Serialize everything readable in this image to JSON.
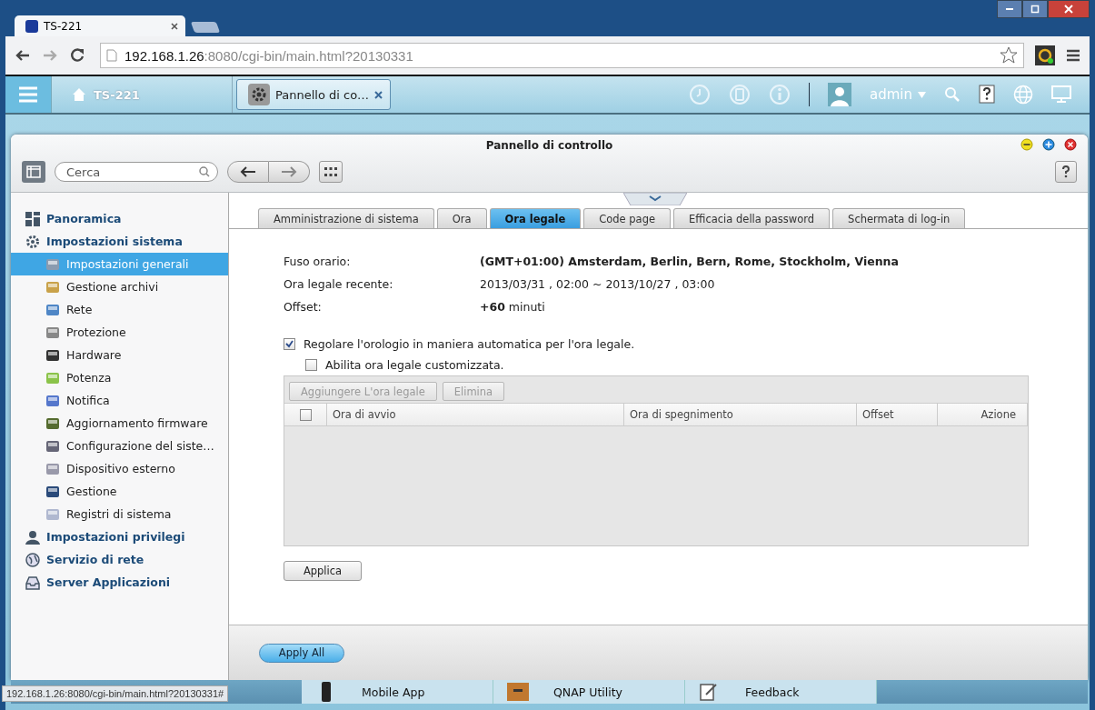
{
  "browser": {
    "tab_title": "TS-221",
    "url_host": "192.168.1.26",
    "url_rest": ":8080/cgi-bin/main.html?20130331"
  },
  "top_bar": {
    "home_label": "TS-221",
    "app_tab": "Pannello di co…",
    "user": "admin"
  },
  "window": {
    "title": "Pannello di controllo",
    "search": {
      "placeholder": "Cerca"
    }
  },
  "sidebar": {
    "items": [
      {
        "label": "Panoramica",
        "selected": false
      },
      {
        "label": "Impostazioni sistema",
        "selected": false,
        "children": [
          {
            "label": "Impostazioni generali",
            "selected": true
          },
          {
            "label": "Gestione archivi",
            "selected": false
          },
          {
            "label": "Rete",
            "selected": false
          },
          {
            "label": "Protezione",
            "selected": false
          },
          {
            "label": "Hardware",
            "selected": false
          },
          {
            "label": "Potenza",
            "selected": false
          },
          {
            "label": "Notifica",
            "selected": false
          },
          {
            "label": "Aggiornamento firmware",
            "selected": false
          },
          {
            "label": "Configurazione del siste…",
            "selected": false
          },
          {
            "label": "Dispositivo esterno",
            "selected": false
          },
          {
            "label": "Gestione",
            "selected": false
          },
          {
            "label": "Registri di sistema",
            "selected": false
          }
        ]
      },
      {
        "label": "Impostazioni privilegi",
        "selected": false
      },
      {
        "label": "Servizio di rete",
        "selected": false
      },
      {
        "label": "Server Applicazioni",
        "selected": false
      }
    ]
  },
  "tabs": [
    {
      "label": "Amministrazione di sistema",
      "selected": false
    },
    {
      "label": "Ora",
      "selected": false
    },
    {
      "label": "Ora legale",
      "selected": true
    },
    {
      "label": "Code page",
      "selected": false
    },
    {
      "label": "Efficacia della password",
      "selected": false
    },
    {
      "label": "Schermata di log-in",
      "selected": false
    }
  ],
  "fields": [
    {
      "label": "Fuso orario:",
      "value": "(GMT+01:00) Amsterdam, Berlin, Bern, Rome, Stockholm, Vienna",
      "bold": true
    },
    {
      "label": "Ora legale recente:",
      "value": "2013/03/31 , 02:00 ~ 2013/10/27 , 03:00",
      "bold": false
    },
    {
      "label": "Offset:",
      "value": "**+60** minuti",
      "bold": false
    }
  ],
  "options": [
    {
      "label": "Regolare l'orologio in maniera automatica per l'ora legale.",
      "checked": true,
      "children": [
        {
          "label": "Abilita ora legale customizzata.",
          "checked": false
        }
      ]
    }
  ],
  "grid": {
    "buttons": [
      {
        "label": "Aggiungere L'ora legale",
        "disabled": true
      },
      {
        "label": "Elimina",
        "disabled": true
      }
    ],
    "select_all": {
      "checked": false
    },
    "columns": [
      "Ora di avvio",
      "Ora di spegnimento",
      "Offset",
      "Azione"
    ]
  },
  "apply_button": "Applica",
  "footer_button": "Apply All",
  "desktop": {
    "items": [
      "Mobile App",
      "QNAP Utility",
      "Feedback"
    ]
  },
  "status_url": "192.168.1.26:8080/cgi-bin/main.html?20130331#"
}
